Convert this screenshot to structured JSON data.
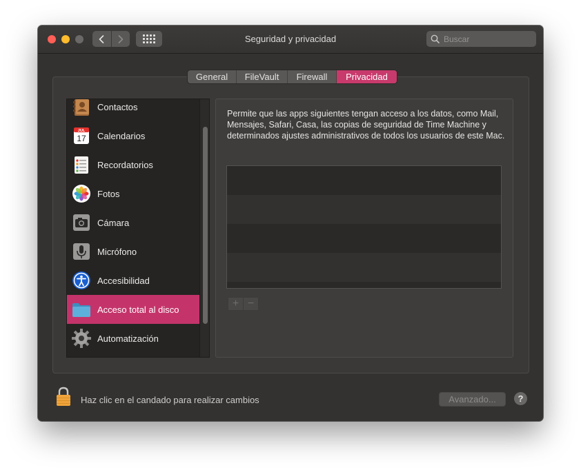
{
  "window": {
    "title": "Seguridad y privacidad"
  },
  "toolbar": {
    "back_icon": "chevron-left-icon",
    "forward_icon": "chevron-right-icon",
    "grid_icon": "show-all-grid-icon"
  },
  "search": {
    "placeholder": "Buscar",
    "icon": "search-icon"
  },
  "tabs": [
    {
      "label": "General",
      "active": false
    },
    {
      "label": "FileVault",
      "active": false
    },
    {
      "label": "Firewall",
      "active": false
    },
    {
      "label": "Privacidad",
      "active": true
    }
  ],
  "sidebar": {
    "items": [
      {
        "label": "Contactos",
        "icon": "contacts-icon"
      },
      {
        "label": "Calendarios",
        "icon": "calendar-icon",
        "icon_month": "JUL",
        "icon_day": "17"
      },
      {
        "label": "Recordatorios",
        "icon": "reminders-icon"
      },
      {
        "label": "Fotos",
        "icon": "photos-icon"
      },
      {
        "label": "Cámara",
        "icon": "camera-icon"
      },
      {
        "label": "Micrófono",
        "icon": "microphone-icon"
      },
      {
        "label": "Accesibilidad",
        "icon": "accessibility-icon"
      },
      {
        "label": "Acceso total al disco",
        "icon": "folder-icon",
        "selected": true
      },
      {
        "label": "Automatización",
        "icon": "gear-icon"
      }
    ]
  },
  "main": {
    "description": "Permite que las apps siguientes tengan acceso a los datos, como Mail, Mensajes, Safari, Casa, las copias de seguridad de Time Machine y determinados ajustes administrativos de todos los usuarios de este Mac.",
    "add_label": "+",
    "remove_label": "−"
  },
  "footer": {
    "lock_text": "Haz clic en el candado para realizar cambios",
    "advanced_label": "Avanzado...",
    "help_label": "?"
  },
  "colors": {
    "accent": "#c83a6c",
    "window_bg": "#343230",
    "close": "#ff5f57",
    "minimize": "#febc2e"
  }
}
